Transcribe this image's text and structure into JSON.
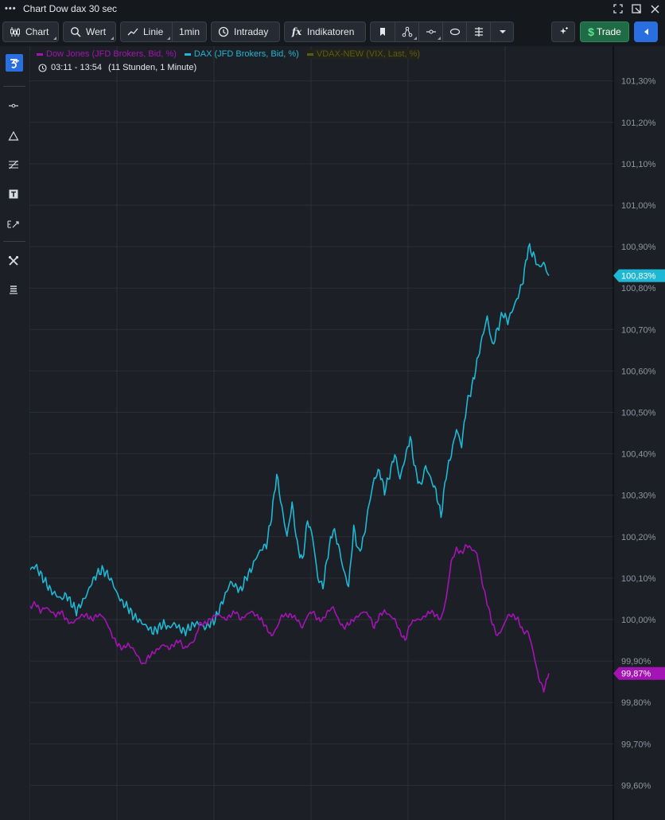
{
  "window": {
    "title": "Chart Dow dax 30 sec",
    "icons": [
      "more-icon",
      "expand-icon",
      "popout-icon",
      "close-icon"
    ]
  },
  "toolbar": {
    "chart_label": "Chart",
    "wert_label": "Wert",
    "linie_label": "Linie",
    "interval_label": "1min",
    "intraday_label": "Intraday",
    "indicators_label": "Indikatoren",
    "trade_label": "Trade"
  },
  "legend": {
    "dow": "Dow Jones (JFD Brokers, Bid, %)",
    "dax": "DAX (JFD Brokers, Bid, %)",
    "vdax": "VDAX-NEW (VIX, Last, %)"
  },
  "timeinfo": {
    "range": "03:11 - 13:54",
    "duration": "(11 Stunden, 1 Minute)"
  },
  "colors": {
    "dax": "#1fb8d4",
    "dow": "#a414b4",
    "vdax": "#5e5a1e",
    "background": "#1c1f26",
    "grid": "#2b2f37",
    "trade": "#1f6b45",
    "accent": "#2a6fe0"
  },
  "chart_data": {
    "type": "line",
    "yaxis_ticks": [
      "101,30%",
      "101,20%",
      "101,10%",
      "101,00%",
      "100,90%",
      "100,80%",
      "100,70%",
      "100,60%",
      "100,50%",
      "100,40%",
      "100,30%",
      "100,20%",
      "100,10%",
      "100,00%",
      "99,90%",
      "99,80%",
      "99,70%",
      "99,60%"
    ],
    "ylim": [
      99.55,
      101.35
    ],
    "x_range": [
      "03:11",
      "13:54"
    ],
    "last_values": {
      "dax": "100,83%",
      "dow": "99,87%"
    },
    "series": [
      {
        "name": "DAX (JFD Brokers, Bid, %)",
        "values": [
          100.12,
          100.13,
          100.11,
          100.09,
          100.07,
          100.06,
          100.05,
          100.06,
          100.04,
          100.02,
          100.04,
          100.06,
          100.09,
          100.11,
          100.12,
          100.11,
          100.09,
          100.06,
          100.04,
          100.03,
          100.01,
          100.0,
          99.99,
          99.98,
          99.97,
          99.98,
          99.99,
          99.98,
          99.99,
          99.98,
          99.97,
          99.98,
          99.99,
          99.99,
          99.98,
          99.99,
          100.0,
          100.03,
          100.06,
          100.09,
          100.08,
          100.07,
          100.1,
          100.12,
          100.15,
          100.17,
          100.18,
          100.25,
          100.35,
          100.27,
          100.2,
          100.28,
          100.18,
          100.14,
          100.24,
          100.2,
          100.1,
          100.08,
          100.16,
          100.22,
          100.18,
          100.12,
          100.08,
          100.22,
          100.16,
          100.2,
          100.28,
          100.34,
          100.36,
          100.31,
          100.35,
          100.4,
          100.34,
          100.39,
          100.44,
          100.36,
          100.32,
          100.37,
          100.34,
          100.31,
          100.25,
          100.35,
          100.4,
          100.46,
          100.42,
          100.52,
          100.56,
          100.62,
          100.68,
          100.73,
          100.66,
          100.7,
          100.74,
          100.72,
          100.75,
          100.78,
          100.82,
          100.9,
          100.88,
          100.85,
          100.86,
          100.83
        ],
        "color": "#1fb8d4"
      },
      {
        "name": "Dow Jones (JFD Brokers, Bid, %)",
        "values": [
          100.03,
          100.04,
          100.02,
          100.03,
          100.02,
          100.01,
          100.02,
          100.0,
          99.99,
          100.0,
          100.01,
          100.01,
          100.0,
          100.01,
          100.01,
          99.99,
          99.96,
          99.94,
          99.93,
          99.94,
          99.93,
          99.91,
          99.89,
          99.91,
          99.92,
          99.93,
          99.94,
          99.93,
          99.94,
          99.95,
          99.93,
          99.94,
          99.95,
          99.99,
          99.99,
          100.0,
          100.01,
          100.01,
          100.0,
          100.01,
          100.02,
          100.0,
          100.01,
          100.02,
          100.01,
          100.0,
          99.98,
          99.96,
          99.98,
          100.01,
          100.01,
          100.01,
          100.0,
          99.98,
          100.01,
          100.02,
          100.0,
          100.0,
          100.02,
          100.03,
          100.0,
          99.98,
          99.99,
          100.0,
          100.01,
          100.02,
          100.01,
          99.98,
          100.01,
          100.02,
          100.01,
          100.0,
          99.97,
          99.95,
          99.99,
          100.0,
          100.0,
          100.01,
          100.02,
          100.01,
          100.0,
          100.05,
          100.14,
          100.17,
          100.16,
          100.18,
          100.17,
          100.16,
          100.09,
          100.04,
          99.99,
          99.96,
          99.98,
          100.01,
          100.01,
          100.0,
          99.97,
          99.97,
          99.92,
          99.86,
          99.83,
          99.87
        ],
        "color": "#a414b4"
      }
    ]
  }
}
